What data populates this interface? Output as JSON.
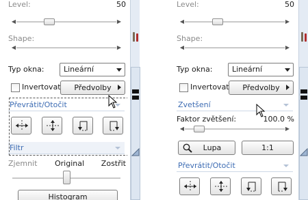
{
  "left_panel": {
    "level": {
      "label": "Level:",
      "value": "50",
      "slider_fraction": 0.31
    },
    "shape": {
      "label": "Shape:"
    },
    "window_type": {
      "label": "Typ okna:",
      "selected": "Lineární"
    },
    "invert": {
      "label": "Invertovat",
      "checked": false
    },
    "presets_button": "Předvolby",
    "flip_rotate": {
      "title": "Převrátit/Otočit"
    },
    "filter": {
      "title": "Filtr",
      "sharpen_label": "Zjemnit",
      "original_label": "Original",
      "sharpen_more_label": "Zostřit",
      "slider_fraction": 0.5
    },
    "histogram_button": "Histogram"
  },
  "right_panel": {
    "level": {
      "label": "Level:",
      "value": "50",
      "slider_fraction": 0.31
    },
    "shape": {
      "label": "Shape:"
    },
    "window_type": {
      "label": "Typ okna:",
      "selected": "Lineární"
    },
    "invert": {
      "label": "Invertovat",
      "checked": false
    },
    "presets_button": "Předvolby",
    "zoom": {
      "title": "Zvetšení",
      "factor_label": "Faktor zvětšení:",
      "factor_value": "100.0 %",
      "slider_fraction": 0.1,
      "magnifier_button": "Lupa",
      "one_to_one_button": "1:1"
    },
    "flip_rotate": {
      "title": "Převrátit/Otočit"
    }
  },
  "icons": {
    "flip_horizontal": "flip-horizontal-icon",
    "flip_vertical": "flip-vertical-icon",
    "rotate_left": "rotate-left-icon",
    "rotate_right": "rotate-right-icon",
    "settings": "tools-icon",
    "magnifier": "magnifier-icon"
  },
  "colors": {
    "section_title": "#3d6cb3",
    "strip_background": "#e4ebf4"
  }
}
